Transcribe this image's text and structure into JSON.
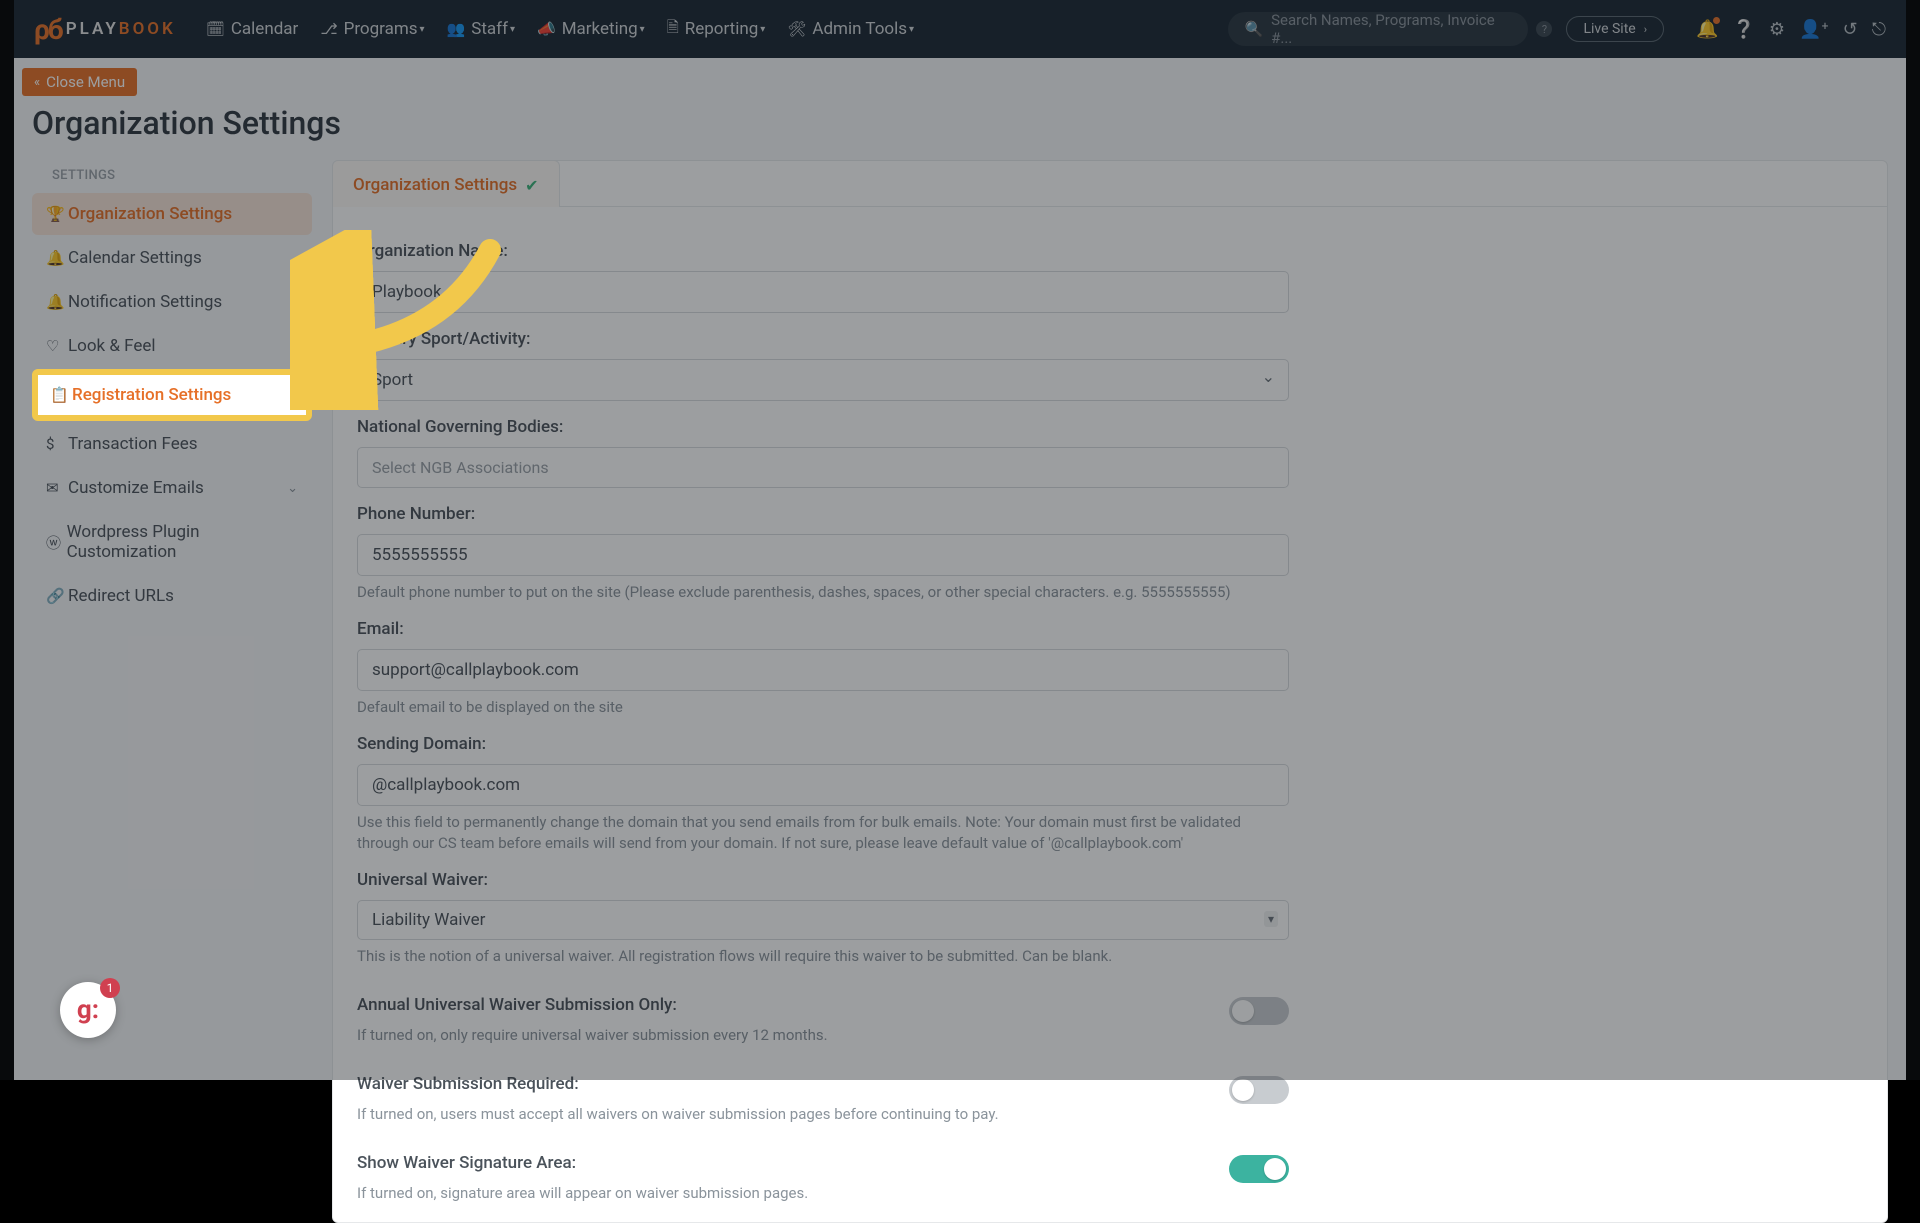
{
  "logo": {
    "text1": "PLAY",
    "text2": "BOOK"
  },
  "nav": {
    "calendar": "Calendar",
    "programs": "Programs",
    "staff": "Staff",
    "marketing": "Marketing",
    "reporting": "Reporting",
    "admin": "Admin Tools"
  },
  "search": {
    "placeholder": "Search Names, Programs, Invoice #..."
  },
  "live_site": "Live Site",
  "close_menu": "Close Menu",
  "page_title": "Organization Settings",
  "sidebar": {
    "label": "SETTINGS",
    "items": [
      {
        "label": "Organization Settings"
      },
      {
        "label": "Calendar Settings"
      },
      {
        "label": "Notification Settings"
      },
      {
        "label": "Look & Feel"
      },
      {
        "label": "Registration Settings"
      },
      {
        "label": "Transaction Fees"
      },
      {
        "label": "Customize Emails"
      },
      {
        "label": "Wordpress Plugin Customization"
      },
      {
        "label": "Redirect URLs"
      }
    ]
  },
  "tab_label": "Organization Settings",
  "form": {
    "org_name_label": "Organization Name:",
    "org_name": "Playbook",
    "sport_label": "Primary Sport/Activity:",
    "sport": "Sport",
    "ngb_label": "National Governing Bodies:",
    "ngb_placeholder": "Select NGB Associations",
    "phone_label": "Phone Number:",
    "phone": "5555555555",
    "phone_help": "Default phone number to put on the site (Please exclude parenthesis, dashes, spaces, or other special characters. e.g. 5555555555)",
    "email_label": "Email:",
    "email": "support@callplaybook.com",
    "email_help": "Default email to be displayed on the site",
    "domain_label": "Sending Domain:",
    "domain": "@callplaybook.com",
    "domain_help": "Use this field to permanently change the domain that you send emails from for bulk emails. Note: Your domain must first be validated through our CS team before emails will send from your domain. If not sure, please leave default value of '@callplaybook.com'",
    "waiver_label": "Universal Waiver:",
    "waiver": "Liability Waiver",
    "waiver_help": "This is the notion of a universal waiver. All registration flows will require this waiver to be submitted. Can be blank.",
    "annual_label": "Annual Universal Waiver Submission Only:",
    "annual_help": "If turned on, only require universal waiver submission every 12 months.",
    "required_label": "Waiver Submission Required:",
    "required_help": "If turned on, users must accept all waivers on waiver submission pages before continuing to pay.",
    "sig_label": "Show Waiver Signature Area:",
    "sig_help": "If turned on, signature area will appear on waiver submission pages."
  },
  "chat_badge": "1"
}
